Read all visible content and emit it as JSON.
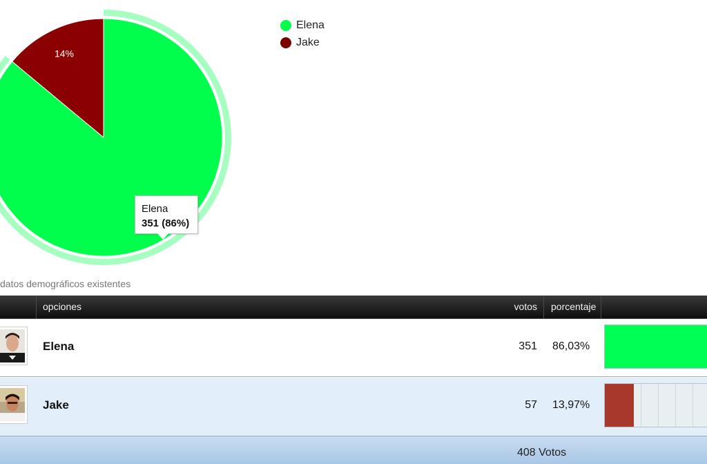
{
  "chart_data": {
    "type": "pie",
    "slices": [
      {
        "label": "Elena",
        "value": 351,
        "percent": 86,
        "color": "#00ff4c"
      },
      {
        "label": "Jake",
        "value": 57,
        "percent": 14,
        "color": "#8b0000"
      }
    ],
    "data_labels": [
      "14%"
    ],
    "legend": [
      "Elena",
      "Jake"
    ],
    "legend_placement": "top-right",
    "highlighted": "Elena"
  },
  "tooltip": {
    "name": "Elena",
    "value_text": "351 (86%)"
  },
  "demographics_text": "datos demográficos existentes",
  "table": {
    "headers": {
      "options": "opciones",
      "votes": "votos",
      "percent": "porcentaje"
    },
    "rows": [
      {
        "name": "Elena",
        "votes": "351",
        "percent": "86,03%",
        "share": 0.8603,
        "color": "#00ff55"
      },
      {
        "name": "Jake",
        "votes": "57",
        "percent": "13,97%",
        "share": 0.1397,
        "color": "#a8382b"
      }
    ],
    "total": "408 Votos"
  }
}
